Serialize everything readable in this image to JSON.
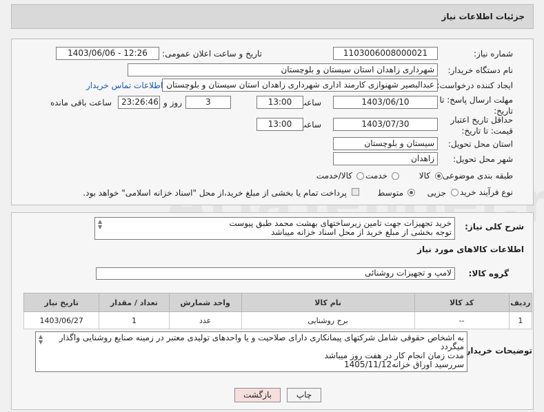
{
  "header": {
    "title": "جزئیات اطلاعات نیاز"
  },
  "fields": {
    "need_number_label": "شماره نیاز:",
    "need_number": "1103006008000021",
    "announce_label": "تاریخ و ساعت اعلان عمومی:",
    "announce_value": "1403/06/06 - 12:26",
    "buyer_org_label": "نام دستگاه خریدار:",
    "buyer_org": "شهرداری زاهدان استان سیستان و بلوچستان",
    "requester_label": "ایجاد کننده درخواست:",
    "requester": "عبدالبصیر شهنوازی کارمند اداری شهرداری زاهدان استان سیستان و بلوچستان",
    "contact_link": "اطلاعات تماس خریدار",
    "reply_deadline_label": "مهلت ارسال پاسخ: تا تاریخ:",
    "reply_date": "1403/06/10",
    "time_label": "ساعت",
    "reply_time": "13:00",
    "days_value": "3",
    "days_label": "روز و",
    "remaining_time": "23:26:46",
    "remaining_label": "ساعت باقی مانده",
    "price_validity_label": "حداقل تاریخ اعتبار قیمت: تا تاریخ:",
    "validity_date": "1403/07/30",
    "validity_time": "13:00",
    "province_label": "استان محل تحویل:",
    "province": "سیستان و بلوچستان",
    "city_label": "شهر محل تحویل:",
    "city": "زاهدان",
    "category_label": "طبقه بندی موضوعی:",
    "category_options": [
      "کالا",
      "خدمت",
      "کالا/خدمت"
    ],
    "process_label": "نوع فرآیند خرید :",
    "process_options": [
      "جزیی",
      "متوسط"
    ],
    "payment_note": "پرداخت تمام یا بخشی از مبلغ خرید،از محل \"اسناد خزانه اسلامی\" خواهد بود."
  },
  "description": {
    "label": "شرح کلی نیاز:",
    "line1": "خرید تجهیزات جهت تامین زیرساختهای بهشت محمد طبق پیوست",
    "line2": "توجه بخشی از مبلغ خرید از محل اسناد خزانه میباشد"
  },
  "goods": {
    "section_title": "اطلاعات کالاهای مورد نیاز",
    "group_label": "گروه کالا:",
    "group_value": "لامپ و تجهیزات روشنائی",
    "columns": [
      "ردیف",
      "کد کالا",
      "نام کالا",
      "واحد شمارش",
      "تعداد / مقدار",
      "تاریخ نیاز"
    ],
    "rows": [
      {
        "row": "1",
        "code": "--",
        "name": "برج روشنایی",
        "unit": "عدد",
        "qty": "1",
        "date": "1403/06/27"
      }
    ]
  },
  "buyer_notes": {
    "label": "توضیحات خریدار:",
    "line1": "به اشخاص حقوقی شامل شرکتهای پیمانکاری دارای صلاحیت و یا واحدهای تولیدی  معتبر در زمینه صنایع روشنایی واگذار",
    "line2": "میگردد",
    "line3": "مدت زمان انجام کار در هفت روز میباشد",
    "line4": "سررسید اوراق خزانه1405/11/12"
  },
  "buttons": {
    "print": "چاپ",
    "back": "بازگشت"
  },
  "watermark": "AriaTender.net",
  "colors": {
    "link": "#1a5bb5",
    "back_button_bg": "#f7dede",
    "header_bg": "#d9d9d9"
  }
}
